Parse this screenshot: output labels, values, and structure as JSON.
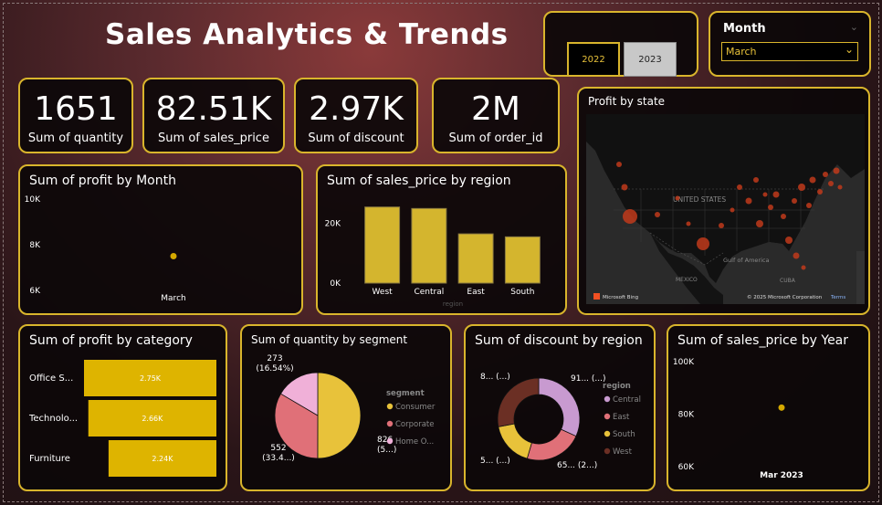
{
  "header": {
    "title": "Sales Analytics & Trends"
  },
  "year_slicer": {
    "options": [
      "2022",
      "2023"
    ],
    "selected": "2022"
  },
  "month_slicer": {
    "label": "Month",
    "selected": "March"
  },
  "kpis": [
    {
      "value": "1651",
      "label": "Sum of quantity"
    },
    {
      "value": "82.51K",
      "label": "Sum of sales_price"
    },
    {
      "value": "2.97K",
      "label": "Sum of discount"
    },
    {
      "value": "2M",
      "label": "Sum of order_id"
    }
  ],
  "map": {
    "title": "Profit by state",
    "country_label": "UNITED STATES",
    "mexico_label": "MEXICO",
    "gulf_label": "Gulf of America",
    "cuba_label": "CUBA",
    "brand": "Microsoft Bing",
    "copyright": "© 2025 Microsoft Corporation",
    "terms": "Terms"
  },
  "colors": {
    "accent": "#d9b52c",
    "bar": "#d4b52e",
    "hbar": "#deb400",
    "point": "#d4a800"
  },
  "chart_data": [
    {
      "id": "profit_by_month",
      "type": "scatter",
      "title": "Sum of profit by Month",
      "categories": [
        "March"
      ],
      "values": [
        7500
      ],
      "ylim": [
        5800,
        10000
      ],
      "yticks": [
        6000,
        8000,
        10000
      ],
      "ytick_labels": [
        "6K",
        "8K",
        "10K"
      ]
    },
    {
      "id": "sales_by_region",
      "type": "bar",
      "title": "Sum of sales_price by region",
      "categories": [
        "West",
        "Central",
        "East",
        "South"
      ],
      "values": [
        25500,
        25000,
        16500,
        15500
      ],
      "ylim": [
        0,
        30000
      ],
      "yticks": [
        0,
        20000
      ],
      "ytick_labels": [
        "0K",
        "20K"
      ],
      "xlabel": "region"
    },
    {
      "id": "profit_by_category",
      "type": "bar",
      "orientation": "horizontal",
      "title": "Sum of profit by category",
      "categories": [
        "Office S...",
        "Technolo...",
        "Furniture"
      ],
      "values": [
        2750,
        2660,
        2240
      ],
      "value_labels": [
        "2.75K",
        "2.66K",
        "2.24K"
      ]
    },
    {
      "id": "quantity_by_segment",
      "type": "pie",
      "title": "Sum of quantity by segment",
      "legend_title": "segment",
      "categories": [
        "Consumer",
        "Corporate",
        "Home O..."
      ],
      "values": [
        826,
        552,
        273
      ],
      "colors": [
        "#e8c23a",
        "#e07078",
        "#f0b0d8"
      ],
      "data_labels": [
        [
          "826",
          "(5...)"
        ],
        [
          "552",
          "(33.4...)"
        ],
        [
          "273",
          "(16.54%)"
        ]
      ],
      "legend_placement": "right"
    },
    {
      "id": "discount_by_region",
      "type": "pie",
      "donut": true,
      "title": "Sum of discount by region",
      "legend_title": "region",
      "categories": [
        "Central",
        "East",
        "South",
        "West"
      ],
      "values": [
        910,
        650,
        500,
        800
      ],
      "colors": [
        "#c89ad0",
        "#e07078",
        "#e8c23a",
        "#6b2f24"
      ],
      "data_labels": [
        "91... (...)",
        "65... (2...)",
        "5... (...)",
        "8... (...)"
      ],
      "legend_placement": "right"
    },
    {
      "id": "sales_by_year",
      "type": "scatter",
      "title": "Sum of sales_price by Year",
      "categories": [
        "Mar 2023"
      ],
      "values": [
        82510
      ],
      "ylim": [
        58000,
        101000
      ],
      "yticks": [
        60000,
        80000,
        100000
      ],
      "ytick_labels": [
        "60K",
        "80K",
        "100K"
      ]
    }
  ]
}
